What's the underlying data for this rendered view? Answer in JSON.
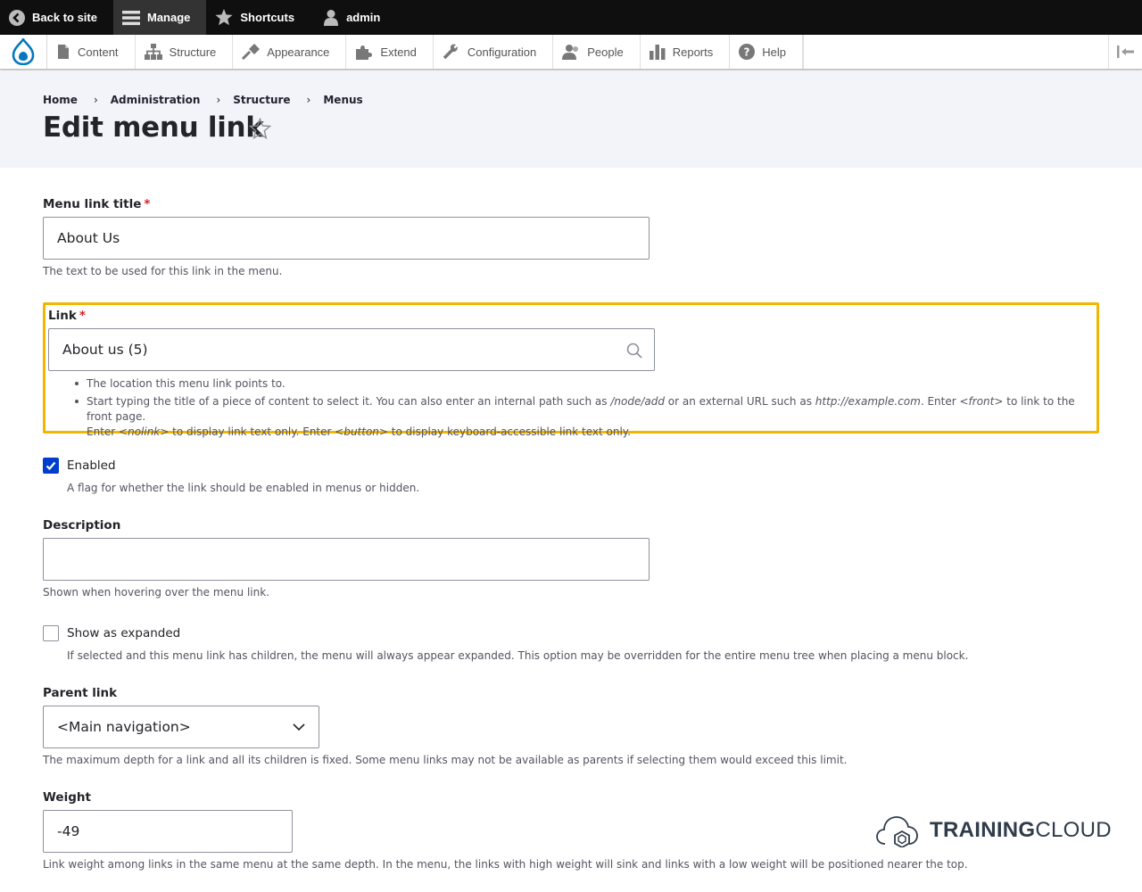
{
  "toolbar": {
    "back_to_site": "Back to site",
    "manage": "Manage",
    "shortcuts": "Shortcuts",
    "user": "admin"
  },
  "tray": {
    "items": [
      "Content",
      "Structure",
      "Appearance",
      "Extend",
      "Configuration",
      "People",
      "Reports",
      "Help"
    ]
  },
  "breadcrumb": [
    "Home",
    "Administration",
    "Structure",
    "Menus"
  ],
  "breadcrumb_sep": "›",
  "page_title": "Edit menu link",
  "form": {
    "menu_link_title": {
      "label": "Menu link title",
      "required_mark": "*",
      "value": "About Us",
      "description": "The text to be used for this link in the menu."
    },
    "link": {
      "label": "Link",
      "required_mark": "*",
      "value": "About us (5)",
      "bullet1": "The location this menu link points to.",
      "bullet2_a": "Start typing the title of a piece of content to select it. You can also enter an internal path such as ",
      "bullet2_b": "/node/add",
      "bullet2_c": " or an external URL such as ",
      "bullet2_d": "http://example.com",
      "bullet2_e": ". Enter ",
      "bullet2_f": "<front>",
      "bullet2_g": " to link to the front page.",
      "bullet2_h": "Enter ",
      "bullet2_i": "<nolink>",
      "bullet2_j": " to display link text only. Enter ",
      "bullet2_k": "<button>",
      "bullet2_l": " to display keyboard-accessible link text only."
    },
    "enabled": {
      "label": "Enabled",
      "checked": true,
      "description": "A flag for whether the link should be enabled in menus or hidden."
    },
    "description_field": {
      "label": "Description",
      "value": "",
      "description": "Shown when hovering over the menu link."
    },
    "expanded": {
      "label": "Show as expanded",
      "checked": false,
      "description": "If selected and this menu link has children, the menu will always appear expanded. This option may be overridden for the entire menu tree when placing a menu block."
    },
    "parent_link": {
      "label": "Parent link",
      "selected": "<Main navigation>",
      "description": "The maximum depth for a link and all its children is fixed. Some menu links may not be available as parents if selecting them would exceed this limit."
    },
    "weight": {
      "label": "Weight",
      "value": "-49",
      "description": "Link weight among links in the same menu at the same depth. In the menu, the links with high weight will sink and links with a low weight will be positioned nearer the top."
    }
  },
  "brand": {
    "bold": "TRAINING",
    "light": "CLOUD"
  },
  "colors": {
    "focus_outline": "#f2b600",
    "checkbox_accent": "#003ecc",
    "required": "#d72222",
    "drupal_blue": "#0678be"
  }
}
